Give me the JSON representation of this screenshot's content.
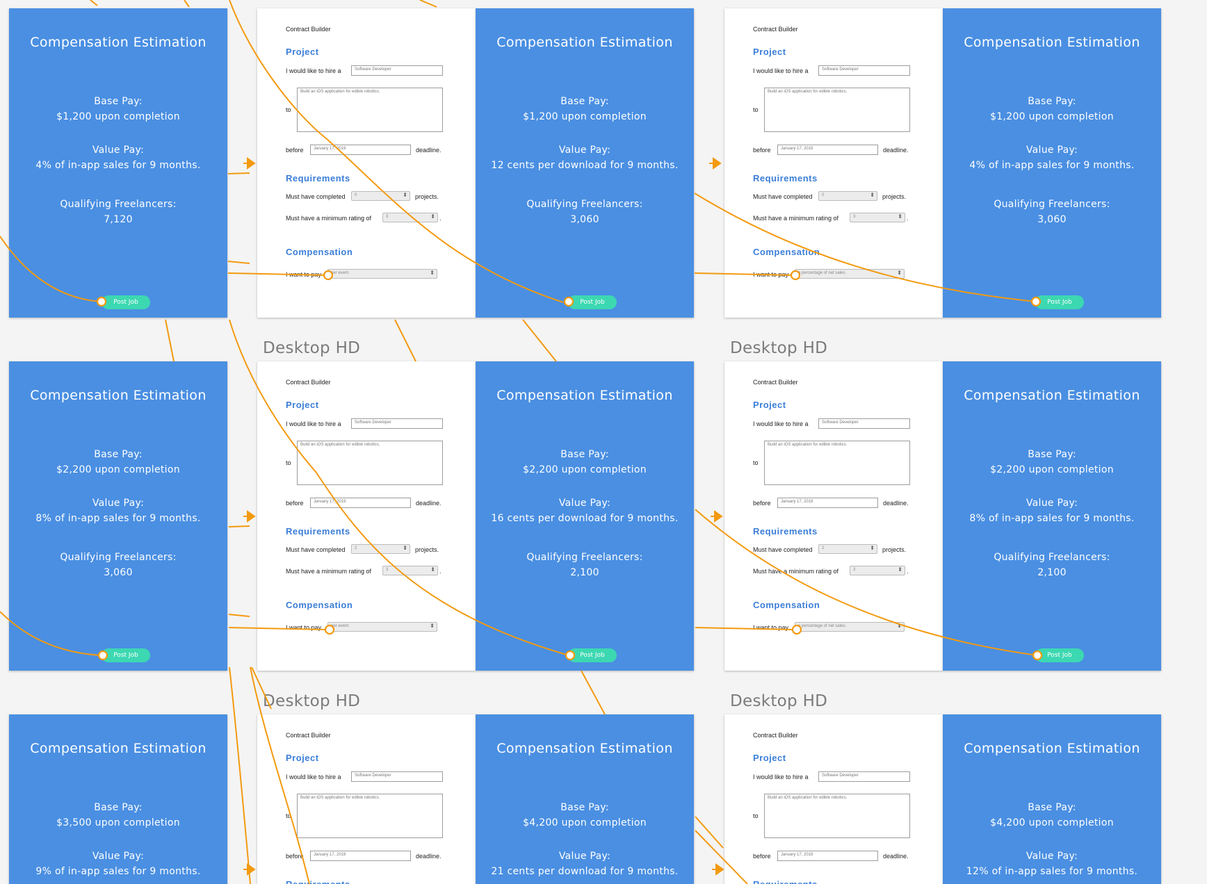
{
  "colors": {
    "panel_blue": "#4a8fe2",
    "button_teal": "#3cd8b1",
    "wire_orange": "#f39a10",
    "section_blue": "#3b7ed8"
  },
  "icons": {
    "arrow": "arrow-right-icon",
    "node": "prototype-hotspot-icon"
  },
  "artboard_label": "Desktop HD",
  "artboards": [
    {
      "label": "",
      "left": {
        "title": "Compensation Estimation",
        "base_label": "Base Pay:",
        "base_value": "$1,200 upon completion",
        "value_label": "Value Pay:",
        "value_value": "4% of in-app sales for 9 months.",
        "qual_label": "Qualifying Freelancers:",
        "qual_value": "7,120",
        "post": "Post Job"
      },
      "form": {
        "header": "Contract Builder",
        "project": "Project",
        "hire_text": "I would like to hire a",
        "hire_value": "Software Developer",
        "to_text": "to",
        "to_value": "Build an iOS application for edible robotics.",
        "before_text": "before",
        "date_value": "January 17, 2019",
        "deadline_text": "deadline.",
        "requirements": "Requirements",
        "completed_text": "Must have completed",
        "completed_value": "0",
        "projects_text": "projects.",
        "rating_text": "Must have a minimum rating of",
        "rating_value": "3",
        "rating_end": ".",
        "compensation": "Compensation",
        "pay_text": "I want to pay",
        "pay_value": "per event."
      },
      "right": {
        "title": "Compensation Estimation",
        "base_label": "Base Pay:",
        "base_value": "$1,200 upon completion",
        "value_label": "Value Pay:",
        "value_value": "12 cents per download for 9 months.",
        "qual_label": "Qualifying Freelancers:",
        "qual_value": "3,060",
        "post": "Post Job"
      }
    },
    {
      "label": "",
      "form": {
        "header": "Contract Builder",
        "project": "Project",
        "hire_text": "I would like to hire a",
        "hire_value": "Software Developer",
        "to_text": "to",
        "to_value": "Build an iOS application for edible robotics.",
        "before_text": "before",
        "date_value": "January 17, 2019",
        "deadline_text": "deadline.",
        "requirements": "Requirements",
        "completed_text": "Must have completed",
        "completed_value": "0",
        "projects_text": "projects.",
        "rating_text": "Must have a minimum rating of",
        "rating_value": "3",
        "rating_end": ".",
        "compensation": "Compensation",
        "pay_text": "I want to pay",
        "pay_value": "a percentage of net sales."
      },
      "right": {
        "title": "Compensation Estimation",
        "base_label": "Base Pay:",
        "base_value": "$1,200 upon completion",
        "value_label": "Value Pay:",
        "value_value": "4% of in-app sales for 9 months.",
        "qual_label": "Qualifying Freelancers:",
        "qual_value": "3,060",
        "post": "Post Job"
      }
    },
    {
      "label": "Desktop HD",
      "left": {
        "title": "Compensation Estimation",
        "base_label": "Base Pay:",
        "base_value": "$2,200 upon completion",
        "value_label": "Value Pay:",
        "value_value": "8% of in-app sales for 9 months.",
        "qual_label": "Qualifying Freelancers:",
        "qual_value": "3,060",
        "post": "Post Job"
      },
      "form": {
        "header": "Contract Builder",
        "project": "Project",
        "hire_text": "I would like to hire a",
        "hire_value": "Software Developer",
        "to_text": "to",
        "to_value": "Build an iOS application for edible robotics.",
        "before_text": "before",
        "date_value": "January 17, 2019",
        "deadline_text": "deadline.",
        "requirements": "Requirements",
        "completed_text": "Must have completed",
        "completed_value": "2",
        "projects_text": "projects.",
        "rating_text": "Must have a minimum rating of",
        "rating_value": "3",
        "rating_end": ".",
        "compensation": "Compensation",
        "pay_text": "I want to pay",
        "pay_value": "per event."
      },
      "right": {
        "title": "Compensation Estimation",
        "base_label": "Base Pay:",
        "base_value": "$2,200 upon completion",
        "value_label": "Value Pay:",
        "value_value": "16 cents per download for 9 months.",
        "qual_label": "Qualifying Freelancers:",
        "qual_value": "2,100",
        "post": "Post Job"
      }
    },
    {
      "label": "Desktop HD",
      "form": {
        "header": "Contract Builder",
        "project": "Project",
        "hire_text": "I would like to hire a",
        "hire_value": "Software Developer",
        "to_text": "to",
        "to_value": "Build an iOS application for edible robotics.",
        "before_text": "before",
        "date_value": "January 17, 2019",
        "deadline_text": "deadline.",
        "requirements": "Requirements",
        "completed_text": "Must have completed",
        "completed_value": "2",
        "projects_text": "projects.",
        "rating_text": "Must have a minimum rating of",
        "rating_value": "3",
        "rating_end": ".",
        "compensation": "Compensation",
        "pay_text": "I want to pay",
        "pay_value": "a percentage of net sales."
      },
      "right": {
        "title": "Compensation Estimation",
        "base_label": "Base Pay:",
        "base_value": "$2,200 upon completion",
        "value_label": "Value Pay:",
        "value_value": "8% of in-app sales for 9 months.",
        "qual_label": "Qualifying Freelancers:",
        "qual_value": "2,100",
        "post": "Post Job"
      }
    },
    {
      "label": "Desktop HD",
      "left": {
        "title": "Compensation Estimation",
        "base_label": "Base Pay:",
        "base_value": "$3,500 upon completion",
        "value_label": "Value Pay:",
        "value_value": "9% of in-app sales for 9 months.",
        "qual_label": "",
        "qual_value": "",
        "post": ""
      },
      "form": {
        "header": "Contract Builder",
        "project": "Project",
        "hire_text": "I would like to hire a",
        "hire_value": "Software Developer",
        "to_text": "to",
        "to_value": "Build an iOS application for edible robotics.",
        "before_text": "before",
        "date_value": "January 17, 2019",
        "deadline_text": "deadline.",
        "requirements": "Requirements"
      },
      "right": {
        "title": "Compensation Estimation",
        "base_label": "Base Pay:",
        "base_value": "$4,200 upon completion",
        "value_label": "Value Pay:",
        "value_value": "21 cents per download for 9 months.",
        "qual_label": "",
        "qual_value": "",
        "post": ""
      }
    },
    {
      "label": "Desktop HD",
      "form": {
        "header": "Contract Builder",
        "project": "Project",
        "hire_text": "I would like to hire a",
        "hire_value": "Software Developer",
        "to_text": "to",
        "to_value": "Build an iOS application for edible robotics.",
        "before_text": "before",
        "date_value": "January 17, 2019",
        "deadline_text": "deadline.",
        "requirements": "Requirements"
      },
      "right": {
        "title": "Compensation Estimation",
        "base_label": "Base Pay:",
        "base_value": "$4,200 upon completion",
        "value_label": "Value Pay:",
        "value_value": "12% of in-app sales for 9 months.",
        "qual_label": "",
        "qual_value": "",
        "post": ""
      }
    }
  ]
}
